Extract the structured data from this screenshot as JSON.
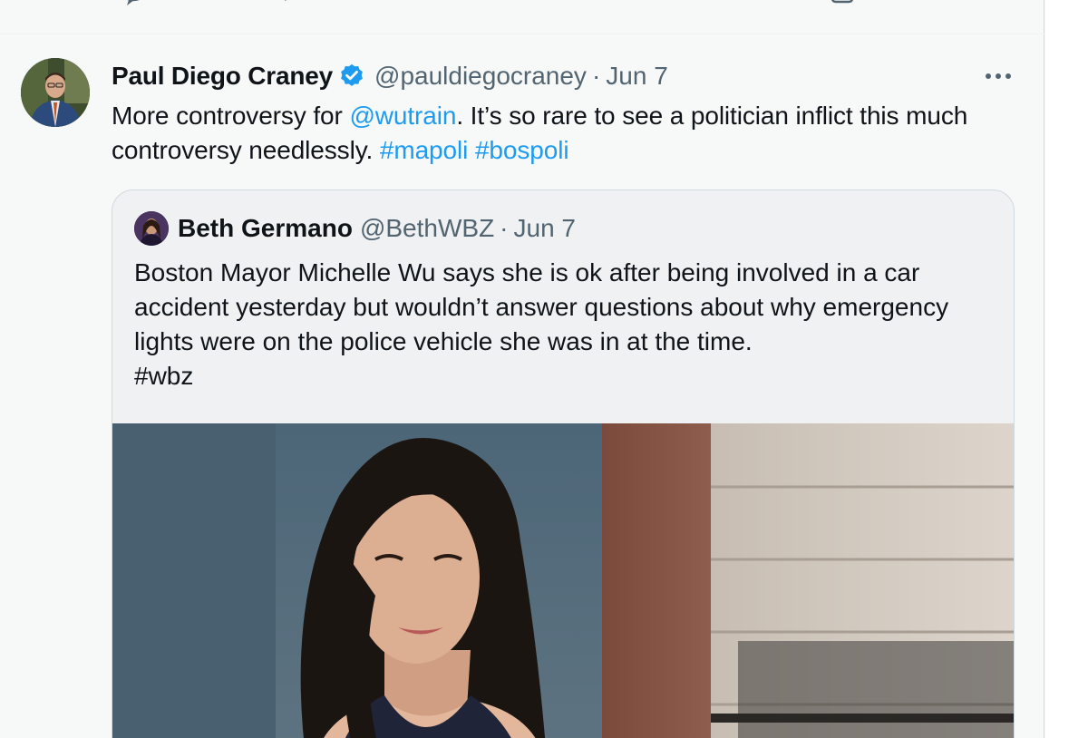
{
  "tweet": {
    "author_name": "Paul Diego Craney",
    "author_handle": "@pauldiegocraney",
    "separator": "·",
    "date": "Jun 7",
    "text_part1": "More controversy for ",
    "mention": "@wutrain",
    "text_part2": ". It’s so rare to see a politician inflict this much controversy needlessly. ",
    "hashtag1": "#mapoli",
    "space": " ",
    "hashtag2": "#bospoli"
  },
  "quote": {
    "author_name": "Beth Germano",
    "author_handle": "@BethWBZ",
    "separator": "·",
    "date": "Jun 7",
    "text": "Boston Mayor Michelle Wu says she is ok after being involved in a car accident yesterday but wouldn’t answer questions about why emergency lights were on the police vehicle she was in at the time.",
    "hashtag": "#wbz"
  },
  "icons": {
    "verified": "verified-badge-icon",
    "more": "more-options-icon"
  },
  "colors": {
    "link": "#1d9bf0",
    "secondary_text": "#536471",
    "verified": "#1d9bf0",
    "card_border": "#cfd9de"
  }
}
